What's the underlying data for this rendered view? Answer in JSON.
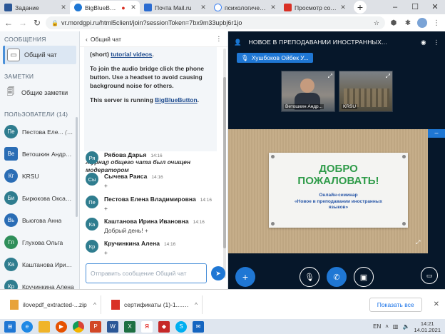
{
  "browser": {
    "tabs": [
      {
        "title": "Задание",
        "favicon_color": "#2b5797"
      },
      {
        "title": "BigBlueButton",
        "favicon_color": "#1f77d4",
        "active": true
      },
      {
        "title": "Почта Mail.ru",
        "favicon_color": "#2b6cd1"
      },
      {
        "title": "психологические",
        "favicon_color": "#4285f4"
      },
      {
        "title": "Просмотр сообщ",
        "favicon_color": "#d93025"
      }
    ],
    "new_tab_label": "+",
    "url": "vr.mordgpi.ru/html5client/join?sessionToken=7bx9m33upbj6r1jo"
  },
  "userlist": {
    "messages_header": "СООБЩЕНИЯ",
    "public_chat_label": "Общий чат",
    "notes_header": "ЗАМЕТКИ",
    "shared_notes_label": "Общие заметки",
    "users_header": "ПОЛЬЗОВАТЕЛИ (14)",
    "users": [
      {
        "initials": "Пе",
        "name": "Пестова Еле...",
        "you": "(Вы)",
        "color": "#2f7d8f"
      },
      {
        "initials": "Ве",
        "name": "Ветошкин Андрей...",
        "you": "",
        "color": "#2a6db5"
      },
      {
        "initials": "Кг",
        "name": "KRSU",
        "you": "",
        "color": "#2a6db5"
      },
      {
        "initials": "Би",
        "name": "Бирюкова Оксана...",
        "you": "",
        "color": "#2f7d8f"
      },
      {
        "initials": "Вь",
        "name": "Вьюгова Анна",
        "you": "",
        "color": "#2a6db5"
      },
      {
        "initials": "Гл",
        "name": "Глухова Ольга",
        "you": "",
        "color": "#2f8f5a"
      },
      {
        "initials": "Ка",
        "name": "Каштанова Ирина...",
        "you": "",
        "color": "#2f7d8f"
      },
      {
        "initials": "Кр",
        "name": "Кручинкина Алена",
        "you": "",
        "color": "#2f7d8f"
      }
    ]
  },
  "chat": {
    "title": "Общий чат",
    "welcome_lines": [
      "(short) ",
      "tutorial videos",
      "."
    ],
    "welcome_p2": "To join the audio bridge click the phone button. Use a headset to avoid causing background noise for others.",
    "welcome_p3_prefix": "This server is running ",
    "welcome_p3_link": "BigBlueButton",
    "welcome_p3_suffix": ".",
    "cleared_notice": "Журнал общего чата был очищен модератором",
    "messages": [
      {
        "initials": "Ря",
        "name": "Рябова Дарья",
        "time": "14:16",
        "text": "+"
      },
      {
        "initials": "Сы",
        "name": "Сычева Раиса",
        "time": "14:16",
        "text": "+"
      },
      {
        "initials": "Пе",
        "name": "Пестова Елена Владимировна",
        "time": "14:16",
        "text": "+"
      },
      {
        "initials": "Ка",
        "name": "Каштанова Ирина Ивановна",
        "time": "14:16",
        "text": "Добрый день! +"
      },
      {
        "initials": "Кр",
        "name": "Кручинкина Алена",
        "time": "14:16",
        "text": "+"
      }
    ],
    "input_placeholder": "Отправить сообщение Общий чат"
  },
  "stage": {
    "meeting_title": "НОВОЕ В ПРЕПОДАВАНИИ ИНОСТРАННЫХ...",
    "speaker": "Хушбоков Ойбек У...",
    "videos": [
      {
        "label": "Ветошкин Андр..."
      },
      {
        "label": "KRSU"
      }
    ],
    "slide": {
      "title_line1": "ДОБРО",
      "title_line2": "ПОЖАЛОВАТЬ!",
      "subtitle": "Онлайн-семинар",
      "subtitle2": "«Новое в преподавании иностранных языков»"
    }
  },
  "downloads": {
    "items": [
      {
        "name": "ilovepdf_extracted-...zip",
        "icon_color": "#e8a33a"
      },
      {
        "name": "сертификаты (1)-1....pdf",
        "icon_color": "#d93025"
      }
    ],
    "show_all": "Показать все"
  },
  "taskbar": {
    "lang": "EN",
    "time": "14:21",
    "date": "14.01.2021"
  }
}
